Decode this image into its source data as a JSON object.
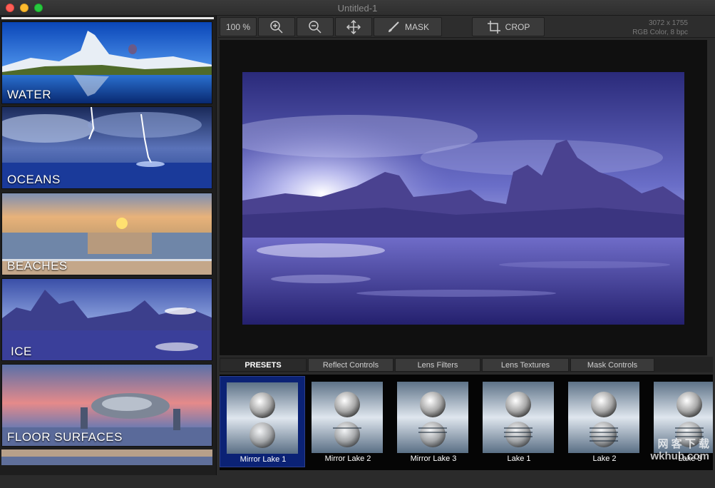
{
  "window": {
    "title": "Untitled-1"
  },
  "sidebar": {
    "categories": [
      {
        "label": "WATER"
      },
      {
        "label": "OCEANS"
      },
      {
        "label": "BEACHES"
      },
      {
        "label": "ICE"
      },
      {
        "label": "FLOOR SURFACES"
      }
    ]
  },
  "toolbar": {
    "zoom_label": "100 %",
    "zoom_in_icon": "zoom-in-icon",
    "zoom_out_icon": "zoom-out-icon",
    "move_icon": "move-icon",
    "mask_label": "MASK",
    "crop_label": "CROP",
    "doc_size": "3072 x 1755",
    "doc_mode": "RGB Color, 8 bpc"
  },
  "tabs": [
    {
      "label": "PRESETS",
      "active": true
    },
    {
      "label": "Reflect Controls"
    },
    {
      "label": "Lens Filters"
    },
    {
      "label": "Lens Textures"
    },
    {
      "label": "Mask Controls"
    }
  ],
  "presets": [
    {
      "label": "Mirror Lake 1",
      "selected": true
    },
    {
      "label": "Mirror Lake 2"
    },
    {
      "label": "Mirror Lake 3"
    },
    {
      "label": "Lake 1"
    },
    {
      "label": "Lake 2"
    },
    {
      "label": "Lake 3"
    }
  ],
  "watermark": {
    "line1": "网 客 下 载",
    "line2": "wkhub.com"
  },
  "colors": {
    "selected_preset": "#0b2275",
    "background": "#2b2b2b"
  }
}
